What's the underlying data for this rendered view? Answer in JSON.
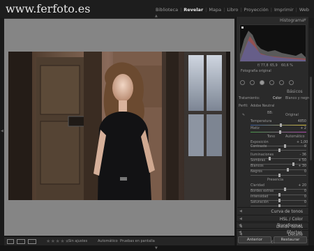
{
  "site": {
    "logo": "www.ferfoto.es"
  },
  "modules": [
    "Biblioteca",
    "Revelar",
    "Mapa",
    "Libro",
    "Proyección",
    "Imprimir",
    "Web"
  ],
  "active_module": "Revelar",
  "histogram": {
    "title": "Histograma",
    "readouts": [
      "f/ 77,8",
      "65,9",
      "60,6 %"
    ],
    "original_label": "Fotografía original"
  },
  "basic": {
    "title": "Básicos",
    "treatment_label": "Tratamiento:",
    "treatment_color": "Color",
    "treatment_bw": "Blanco y negro",
    "profile_label": "Perfil:",
    "profile_value": "Adobe Neutral",
    "wb_label": "BB:",
    "wb_value": "Original",
    "temp_label": "Temperatura",
    "temp_value": "4850",
    "tint_label": "Matiz",
    "tint_value": "+ 2",
    "tone_label": "Tono",
    "tone_auto": "Automático",
    "exposure_label": "Exposición",
    "exposure_value": "+ 1,00",
    "contrast_label": "Contraste",
    "contrast_value": "0",
    "highlights_label": "Iluminaciones",
    "highlights_value": "- 36",
    "shadows_label": "Sombras",
    "shadows_value": "+ 50",
    "whites_label": "Blancos",
    "whites_value": "+ 30",
    "blacks_label": "Negros",
    "blacks_value": "0",
    "presence_label": "Presencia",
    "clarity_label": "Claridad",
    "clarity_value": "+ 20",
    "dehaze_label": "Bordes extras",
    "dehaze_value": "0",
    "vibrance_label": "Intensidad",
    "vibrance_value": "0",
    "saturation_label": "Saturación",
    "saturation_value": "0"
  },
  "sections": [
    "Curva de tonos",
    "HSL / Color",
    "Dividir tonos",
    "Detalle",
    "Correcciones de lente",
    "Transformar",
    "Efectos"
  ],
  "buttons": {
    "previous": "Anterior",
    "reset": "Restaurar"
  },
  "filmstrip": {
    "view_label": "Sin ajustes",
    "mode_label": "Automático",
    "screen_label": "Pruebas en pantalla",
    "stars": "★★★★★"
  },
  "colors": {
    "accent": "#e8e8e8",
    "panel": "#2a2a2a",
    "canvas": "#858585"
  }
}
